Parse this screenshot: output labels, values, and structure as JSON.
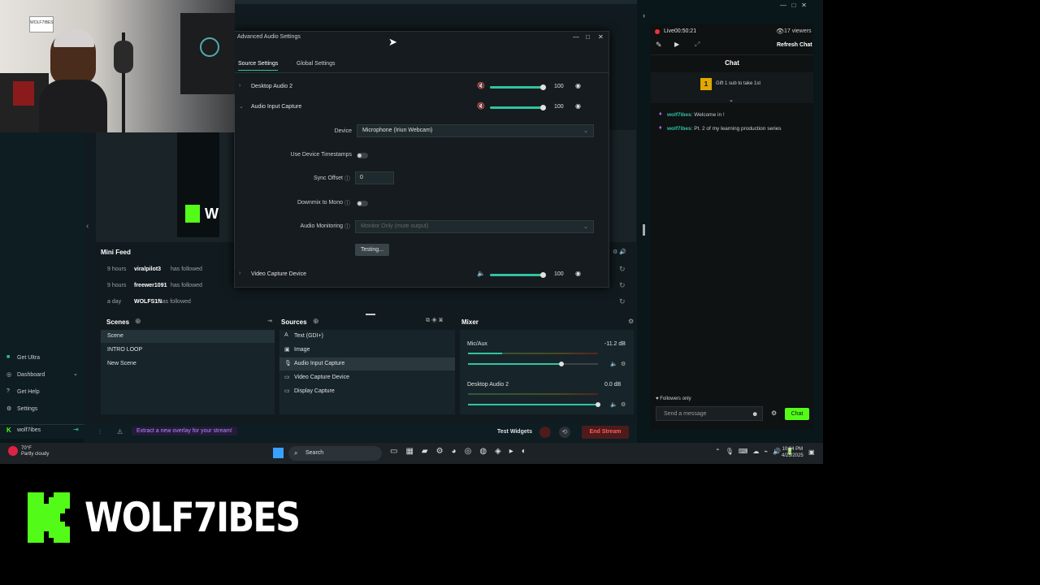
{
  "webcam": {
    "sticker_text": "WOLF7IBES"
  },
  "dialog": {
    "title": "Advanced Audio Settings",
    "tabs": [
      {
        "label": "Source Settings"
      },
      {
        "label": "Global Settings"
      }
    ],
    "sources": [
      {
        "name": "Desktop Audio 2",
        "volume": "100",
        "level": 1.0
      },
      {
        "name": "Audio Input Capture",
        "volume": "100",
        "level": 1.0
      },
      {
        "name": "Video Capture Device",
        "volume": "100",
        "level": 1.0
      }
    ],
    "form": {
      "device_label": "Device",
      "device_value": "Microphone (Iriun Webcam)",
      "timestamps_label": "Use Device Timestamps",
      "sync_label": "Sync Offset",
      "sync_value": "0",
      "downmix_label": "Downmix to Mono",
      "monitoring_label": "Audio Monitoring",
      "monitoring_value": "Monitor Only (mute output)",
      "testing_button": "Testing..."
    }
  },
  "mini_feed": {
    "title": "Mini Feed",
    "items": [
      {
        "time": "9 hours",
        "user": "viralpilot3",
        "action": "has followed"
      },
      {
        "time": "9 hours",
        "user": "freewer1091",
        "action": "has followed"
      },
      {
        "time": "a day",
        "user": "WOLFS1N",
        "action": "has followed"
      }
    ]
  },
  "preview": {
    "logo_text": "W"
  },
  "scenes": {
    "title": "Scenes",
    "items": [
      {
        "label": "Scene"
      },
      {
        "label": "INTRO LOOP"
      },
      {
        "label": "New Scene"
      }
    ]
  },
  "sources": {
    "title": "Sources",
    "items": [
      {
        "label": "Text (GDI+)",
        "icon": "A"
      },
      {
        "label": "Image",
        "icon": "▣"
      },
      {
        "label": "Audio Input Capture",
        "icon": "🎙"
      },
      {
        "label": "Video Capture Device",
        "icon": "▭"
      },
      {
        "label": "Display Capture",
        "icon": "▭"
      }
    ]
  },
  "mixer": {
    "title": "Mixer",
    "channels": [
      {
        "name": "Mic/Aux",
        "db": "-11.2 dB",
        "level": 0.72
      },
      {
        "name": "Desktop Audio 2",
        "db": "0.0 dB",
        "level": 1.0
      }
    ]
  },
  "left_nav": {
    "items": [
      {
        "label": "Get Ultra"
      },
      {
        "label": "Dashboard"
      },
      {
        "label": "Get Help"
      },
      {
        "label": "Settings"
      }
    ],
    "user": "wolf7ibes"
  },
  "footer": {
    "promo": "Extract a new overlay for your stream!",
    "test_widgets": "Test Widgets",
    "end_stream": "End Stream"
  },
  "chat": {
    "live": "Live",
    "timer": "00:50:21",
    "viewers": "17 viewers",
    "refresh": "Refresh Chat",
    "title": "Chat",
    "gift_count": "1",
    "gift_text": "Gift 1 sub to take 1st",
    "messages": [
      {
        "user": "wolf7ibes",
        "text": ": Welcome in !"
      },
      {
        "user": "wolf7ibes",
        "text": ": Pt. 2 of my learning production series"
      }
    ],
    "followers_only": "Followers only",
    "placeholder": "Send a message",
    "send": "Chat"
  },
  "taskbar": {
    "temp": "70°F",
    "weather": "Partly cloudy",
    "search": "Search",
    "time": "10:34 PM",
    "date": "4/23/2025"
  },
  "brand": {
    "name": "WOLF7IBES",
    "color": "#53fc18"
  }
}
